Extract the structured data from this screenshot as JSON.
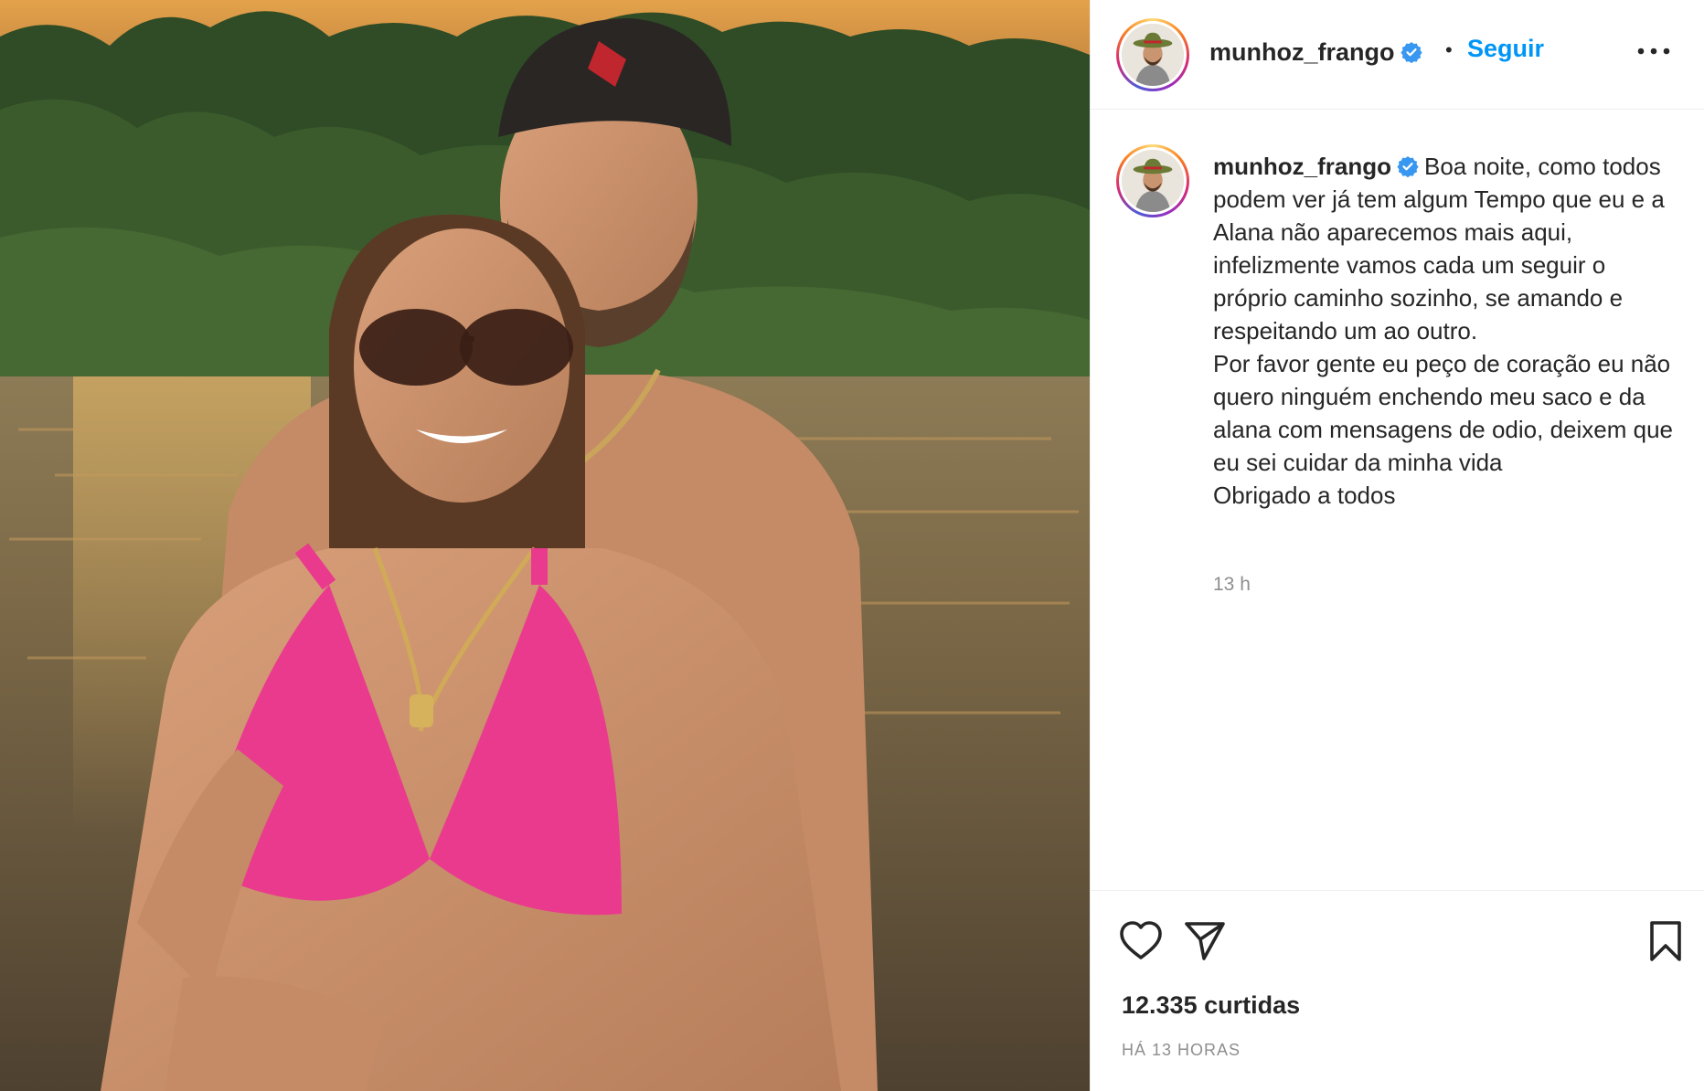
{
  "post": {
    "photo_alt": "",
    "author": "munhoz_frango",
    "follow_label": "Seguir",
    "dot": "•",
    "caption": "Boa noite, como todos podem ver já tem algum Tempo que eu e a Alana não aparecemos mais aqui, infelizmente vamos cada um seguir o próprio caminho sozinho, se amando e respeitando um ao outro.\nPor favor gente eu peço de coração eu não quero ninguém enchendo meu saco e da alana com mensagens de odio, deixem que eu sei cuidar da minha vida\nObrigado a todos",
    "caption_time": "13 h",
    "likes": "12.335 curtidas",
    "posted_ago": "HÁ 13 HORAS"
  },
  "icons": {
    "verified": "verified-badge-icon",
    "more": "more-options-icon",
    "like": "heart-icon",
    "share": "paper-plane-icon",
    "save": "bookmark-icon"
  },
  "colors": {
    "accent": "#0095f6",
    "verified": "#3897f0",
    "muted": "#8e8e8e",
    "text": "#262626"
  }
}
